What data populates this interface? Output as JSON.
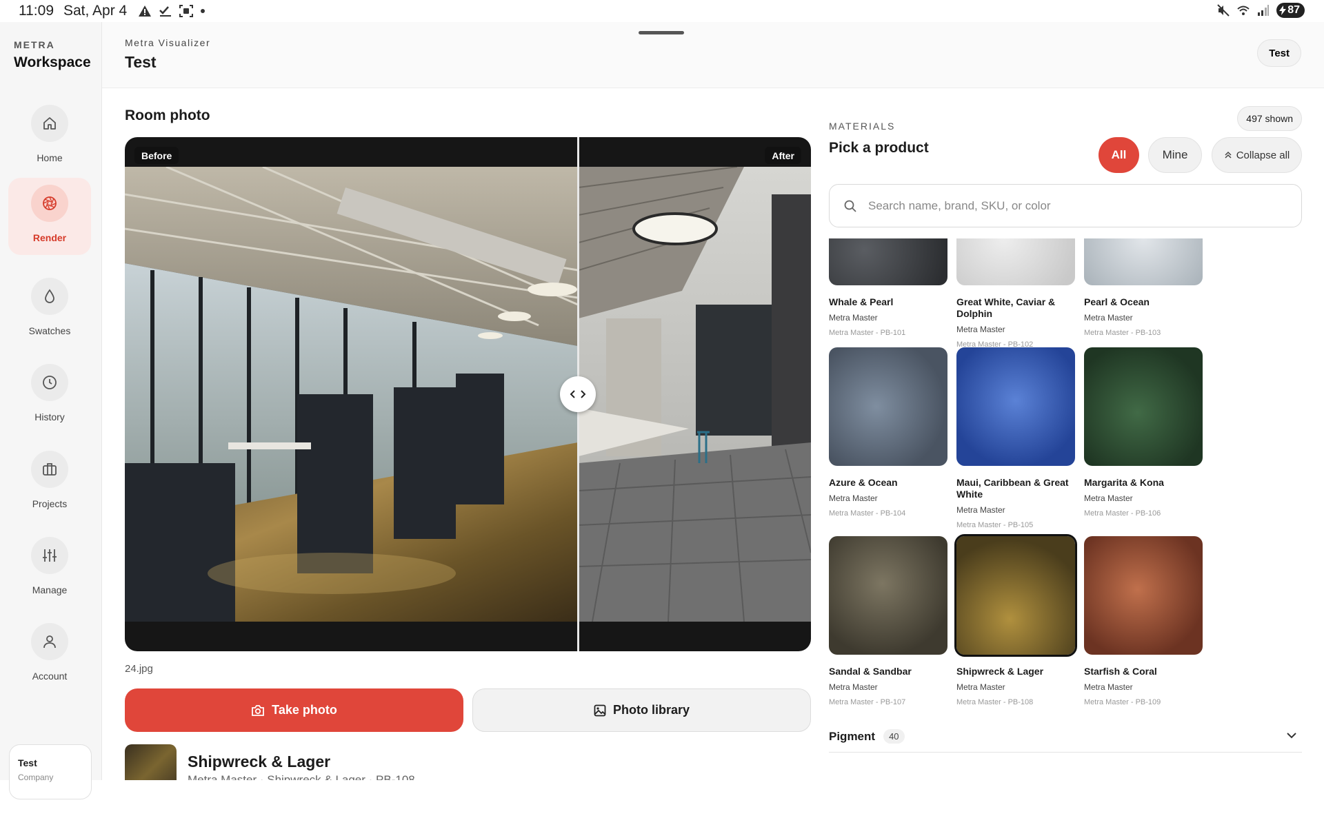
{
  "status": {
    "time": "11:09",
    "date": "Sat, Apr 4",
    "battery": "87"
  },
  "sidebar": {
    "brand_small": "METRA",
    "brand_big": "Workspace",
    "items": [
      {
        "label": "Home",
        "icon": "home-icon"
      },
      {
        "label": "Render",
        "icon": "aperture-icon",
        "active": true
      },
      {
        "label": "Swatches",
        "icon": "droplet-icon"
      },
      {
        "label": "History",
        "icon": "clock-icon"
      },
      {
        "label": "Projects",
        "icon": "briefcase-icon"
      },
      {
        "label": "Manage",
        "icon": "sliders-icon"
      },
      {
        "label": "Account",
        "icon": "person-icon"
      }
    ],
    "user": {
      "name": "Test",
      "company": "Company"
    }
  },
  "header": {
    "subtitle": "Metra Visualizer",
    "title": "Test",
    "user_button": "Test"
  },
  "room": {
    "title": "Room photo",
    "before_label": "Before",
    "after_label": "After",
    "filename": "24.jpg",
    "take_photo": "Take photo",
    "photo_library": "Photo library",
    "selected": {
      "name": "Shipwreck & Lager",
      "meta": "Metra Master · Shipwreck & Lager · PB-108"
    }
  },
  "materials": {
    "overline": "MATERIALS",
    "title": "Pick a product",
    "shown": "497 shown",
    "filters": {
      "all": "All",
      "mine": "Mine",
      "collapse": "Collapse all"
    },
    "search_placeholder": "Search name, brand, SKU, or color",
    "products": [
      {
        "name": "Whale & Pearl",
        "brand": "Metra Master",
        "sku": "Metra Master - PB-101",
        "color": "#3e4044"
      },
      {
        "name": "Great White, Caviar & Dolphin",
        "brand": "Metra Master",
        "sku": "Metra Master - PB-102",
        "color": "#d9dadb"
      },
      {
        "name": "Pearl & Ocean",
        "brand": "Metra Master",
        "sku": "Metra Master - PB-103",
        "color": "#c9cfd4"
      },
      {
        "name": "Azure & Ocean",
        "brand": "Metra Master",
        "sku": "Metra Master - PB-104",
        "color": "#5b6878"
      },
      {
        "name": "Maui, Caribbean & Great White",
        "brand": "Metra Master",
        "sku": "Metra Master - PB-105",
        "color": "#2f53a6"
      },
      {
        "name": "Margarita & Kona",
        "brand": "Metra Master",
        "sku": "Metra Master - PB-106",
        "color": "#2c4a30"
      },
      {
        "name": "Sandal & Sandbar",
        "brand": "Metra Master",
        "sku": "Metra Master - PB-107",
        "color": "#5c5647"
      },
      {
        "name": "Shipwreck & Lager",
        "brand": "Metra Master",
        "sku": "Metra Master - PB-108",
        "color": "#6b5a30",
        "selected": true
      },
      {
        "name": "Starfish & Coral",
        "brand": "Metra Master",
        "sku": "Metra Master - PB-109",
        "color": "#8a4a32"
      }
    ],
    "pigment": {
      "label": "Pigment",
      "count": "40"
    }
  }
}
